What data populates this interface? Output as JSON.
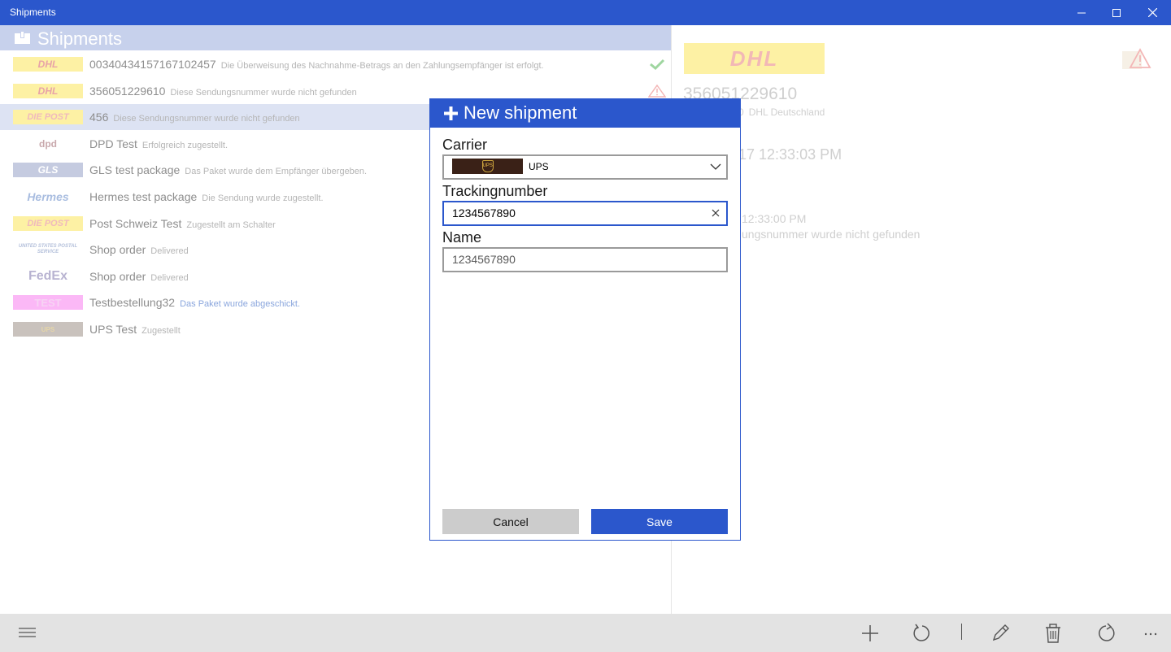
{
  "window": {
    "title": "Shipments"
  },
  "list": {
    "header": "Shipments",
    "rows": [
      {
        "logo": "DHL",
        "title": "00340434157167102457",
        "status": "Die Überweisung des Nachnahme-Betrags an den Zahlungsempfänger ist erfolgt.",
        "flag": "check-icon"
      },
      {
        "logo": "DHL",
        "title": "356051229610",
        "status": "Diese Sendungsnummer wurde nicht gefunden",
        "flag": "warning-icon"
      },
      {
        "logo": "DIE POST",
        "title": "456",
        "status": "Diese Sendungsnummer wurde nicht gefunden"
      },
      {
        "logo": "dpd",
        "title": "DPD Test",
        "status": "Erfolgreich zugestellt."
      },
      {
        "logo": "GLS",
        "title": "GLS test package",
        "status": "Das Paket wurde dem Empfänger übergeben."
      },
      {
        "logo": "Hermes",
        "title": "Hermes test package",
        "status": "Die Sendung wurde zugestellt."
      },
      {
        "logo": "DIE POST",
        "title": "Post Schweiz Test",
        "status": "Zugestellt am Schalter"
      },
      {
        "logo": "UNITED STATES POSTAL SERVICE",
        "title": "Shop order",
        "status": "Delivered"
      },
      {
        "logo": "FedEx",
        "title": "Shop order",
        "status": "Delivered"
      },
      {
        "logo": "TEST",
        "title": "Testbestellung32",
        "status": "Das Paket wurde abgeschickt."
      },
      {
        "logo": "UPS",
        "title": "UPS Test",
        "status": "Zugestellt"
      }
    ]
  },
  "detail": {
    "logo": "DHL",
    "tracking_number": "356051229610",
    "carrier_prefix": "0",
    "carrier_name": "DHL Deutschland",
    "date": "17 12:33:03 PM",
    "event_time": "12:33:00 PM",
    "event_text": "ungsnummer wurde nicht gefunden"
  },
  "dialog": {
    "title": "New shipment",
    "carrier_label": "Carrier",
    "carrier_value": "UPS",
    "carrier_logo_text": "UPS",
    "tracking_label": "Trackingnumber",
    "tracking_value": "1234567890",
    "name_label": "Name",
    "name_placeholder": "1234567890",
    "cancel_label": "Cancel",
    "save_label": "Save"
  },
  "colors": {
    "accent": "#2b57cc",
    "header_bg": "#c7d1ec",
    "selected_row": "#dde3f3",
    "dhl_yellow": "#fdf1a4",
    "command_bar": "#e3e3e3"
  },
  "commands": [
    "hamburger-icon",
    "add-icon",
    "refresh-icon",
    "separator",
    "edit-icon",
    "delete-icon",
    "sync-icon",
    "more-icon"
  ]
}
